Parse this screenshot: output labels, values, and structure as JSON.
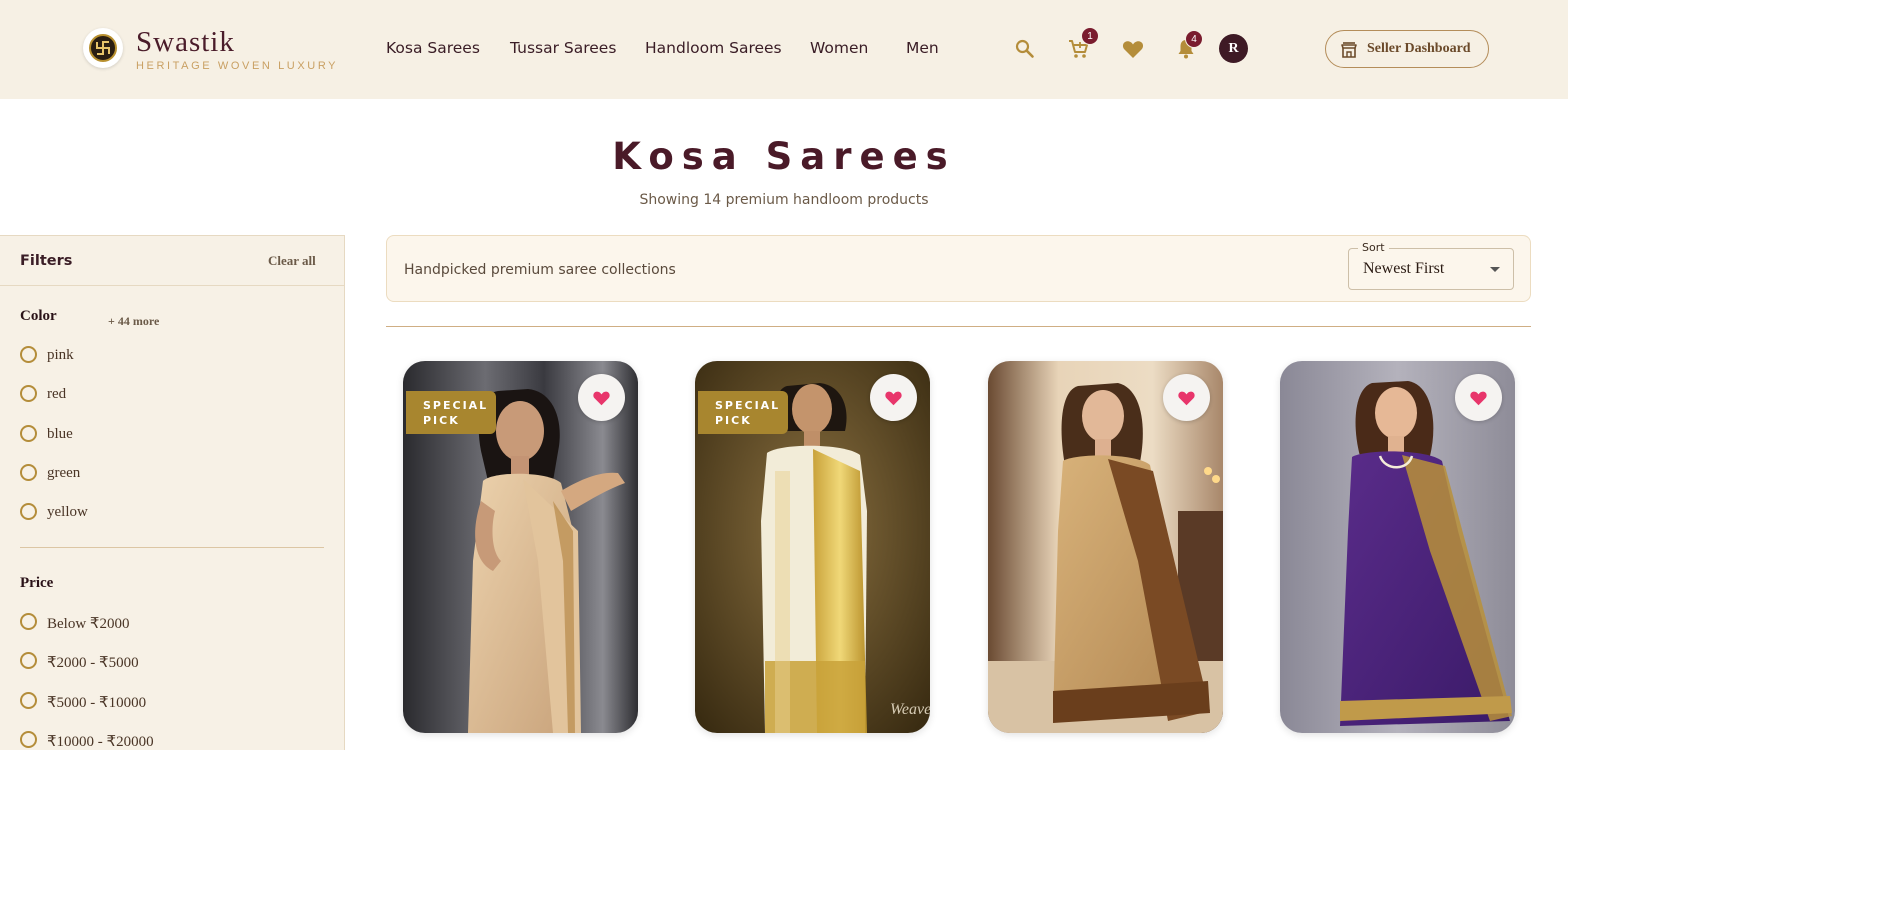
{
  "brand": {
    "name": "Swastik",
    "tagline": "HERITAGE WOVEN LUXURY",
    "logo_icon": "swastika-icon"
  },
  "nav": {
    "items": [
      {
        "label": "Kosa Sarees"
      },
      {
        "label": "Tussar Sarees"
      },
      {
        "label": "Handloom Sarees"
      },
      {
        "label": "Women"
      },
      {
        "label": "Men"
      }
    ]
  },
  "header_actions": {
    "search_icon": "search-icon",
    "cart": {
      "icon": "cart-icon",
      "count": "1"
    },
    "wishlist_icon": "heart-icon",
    "notifications": {
      "icon": "bell-icon",
      "count": "4"
    },
    "avatar_initial": "R",
    "seller_dashboard": {
      "label": "Seller Dashboard",
      "icon": "store-icon"
    }
  },
  "page": {
    "title": "Kosa Sarees",
    "subtitle": "Showing 14 premium handloom products"
  },
  "filters": {
    "title": "Filters",
    "clear_all": "Clear all",
    "color": {
      "title": "Color",
      "more": "+ 44 more",
      "options": [
        "pink",
        "red",
        "blue",
        "green",
        "yellow"
      ]
    },
    "price": {
      "title": "Price",
      "options": [
        "Below ₹2000",
        "₹2000 - ₹5000",
        "₹5000 - ₹10000",
        "₹10000 - ₹20000"
      ]
    }
  },
  "toolbar": {
    "info_text": "Handpicked premium saree collections",
    "sort": {
      "label": "Sort",
      "value": "Newest First"
    }
  },
  "products": [
    {
      "badge": "SPECIAL PICK",
      "badge_line1": "SPECIAL",
      "badge_line2": "PICK",
      "image": "woman-in-beige-kosa-saree"
    },
    {
      "badge": "SPECIAL PICK",
      "badge_line1": "SPECIAL",
      "badge_line2": "PICK",
      "image": "woman-in-ivory-gold-saree",
      "watermark": "Weave"
    },
    {
      "badge": "",
      "image": "woman-in-tan-brown-saree"
    },
    {
      "badge": "",
      "image": "woman-in-purple-saree"
    }
  ],
  "colors": {
    "header_bg": "#f6f0e4",
    "brand_maroon": "#4a1a28",
    "accent_gold": "#b48d3a",
    "badge_red": "#7a1c2e",
    "special_badge": "#a8862f",
    "heart_pink": "#e8356b"
  }
}
